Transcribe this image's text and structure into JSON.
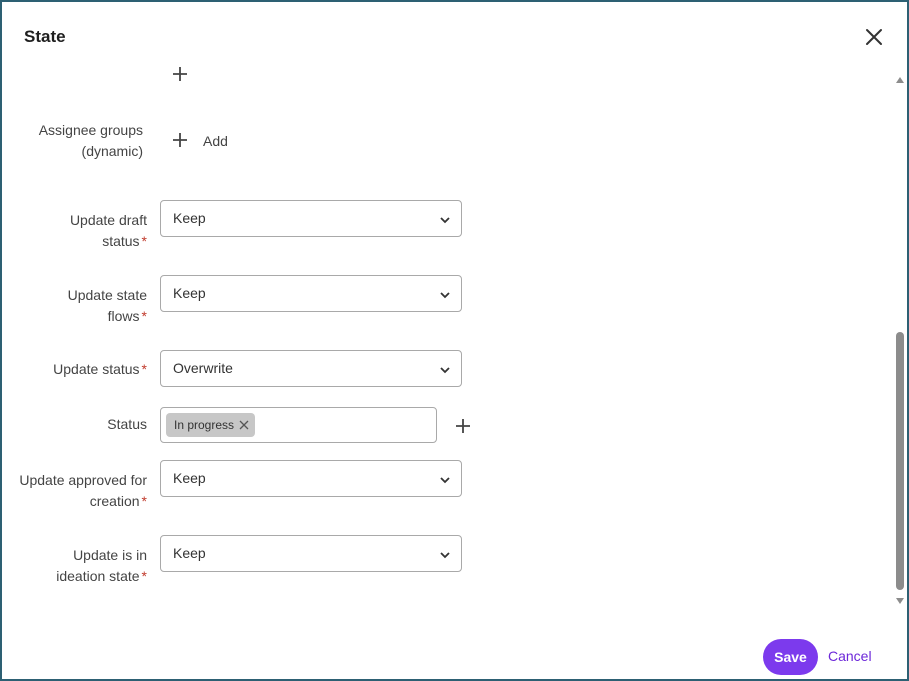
{
  "dialog": {
    "title": "State",
    "icons": {
      "close": "close-icon",
      "plus": "plus-icon",
      "chevron": "chevron-down-icon",
      "chip_remove": "close-icon"
    },
    "colors": {
      "border": "#2d6073",
      "accent": "#7c3aed",
      "required": "#c0392b",
      "chip_bg": "#c7c7c7"
    }
  },
  "form": {
    "assignee_groups": {
      "label": "Assignee groups (dynamic)",
      "add_label": "Add"
    },
    "update_draft_status": {
      "label": "Update draft status",
      "required": "*",
      "value": "Keep"
    },
    "update_state_flows": {
      "label": "Update state flows",
      "required": "*",
      "value": "Keep"
    },
    "update_status": {
      "label": "Update status",
      "required": "*",
      "value": "Overwrite"
    },
    "status": {
      "label": "Status",
      "tags": [
        "In progress"
      ]
    },
    "update_approved_for_creation": {
      "label": "Update approved for creation",
      "required": "*",
      "value": "Keep"
    },
    "update_is_in_ideation_state": {
      "label": "Update is in ideation state",
      "required": "*",
      "value": "Keep"
    }
  },
  "footer": {
    "save_label": "Save",
    "cancel_label": "Cancel"
  }
}
